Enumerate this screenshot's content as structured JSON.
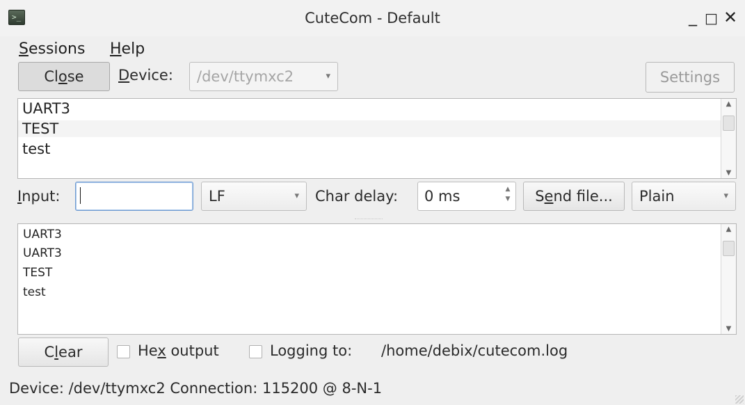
{
  "window": {
    "title": "CuteCom - Default",
    "minimize_glyph": "_",
    "maximize_glyph": "□",
    "close_glyph": "✕",
    "app_icon": "terminal-icon"
  },
  "menubar": {
    "sessions": {
      "prefix": "",
      "mnemonic": "S",
      "rest": "essions"
    },
    "help": {
      "prefix": "",
      "mnemonic": "H",
      "rest": "elp"
    }
  },
  "toolbar": {
    "close_button": {
      "prefix": "Cl",
      "mnemonic": "o",
      "rest": "se"
    },
    "device_label": {
      "prefix": "",
      "mnemonic": "D",
      "rest": "evice:"
    },
    "device_value": "/dev/ttymxc2",
    "settings_label": "Settings"
  },
  "history": {
    "items": [
      "UART3",
      "TEST",
      "test"
    ]
  },
  "input_row": {
    "input_label": {
      "prefix": "",
      "mnemonic": "I",
      "rest": "nput:"
    },
    "input_value": "",
    "line_end": "LF",
    "char_delay_label": "Char delay:",
    "char_delay_value": "0 ms",
    "send_file": {
      "prefix": "S",
      "mnemonic": "e",
      "rest": "nd file..."
    },
    "protocol": "Plain"
  },
  "output": {
    "lines": [
      "UART3",
      "UART3",
      "TEST",
      "test"
    ]
  },
  "bottom": {
    "clear_button": {
      "prefix": "C",
      "mnemonic": "l",
      "rest": "ear"
    },
    "hex_output": {
      "prefix": "He",
      "mnemonic": "x",
      "rest": " output"
    },
    "hex_checked": false,
    "logging_label": "Logging to:",
    "logging_checked": false,
    "log_path": "/home/debix/cutecom.log"
  },
  "statusbar": {
    "text": "Device: /dev/ttymxc2 Connection: 115200 @ 8-N-1"
  }
}
